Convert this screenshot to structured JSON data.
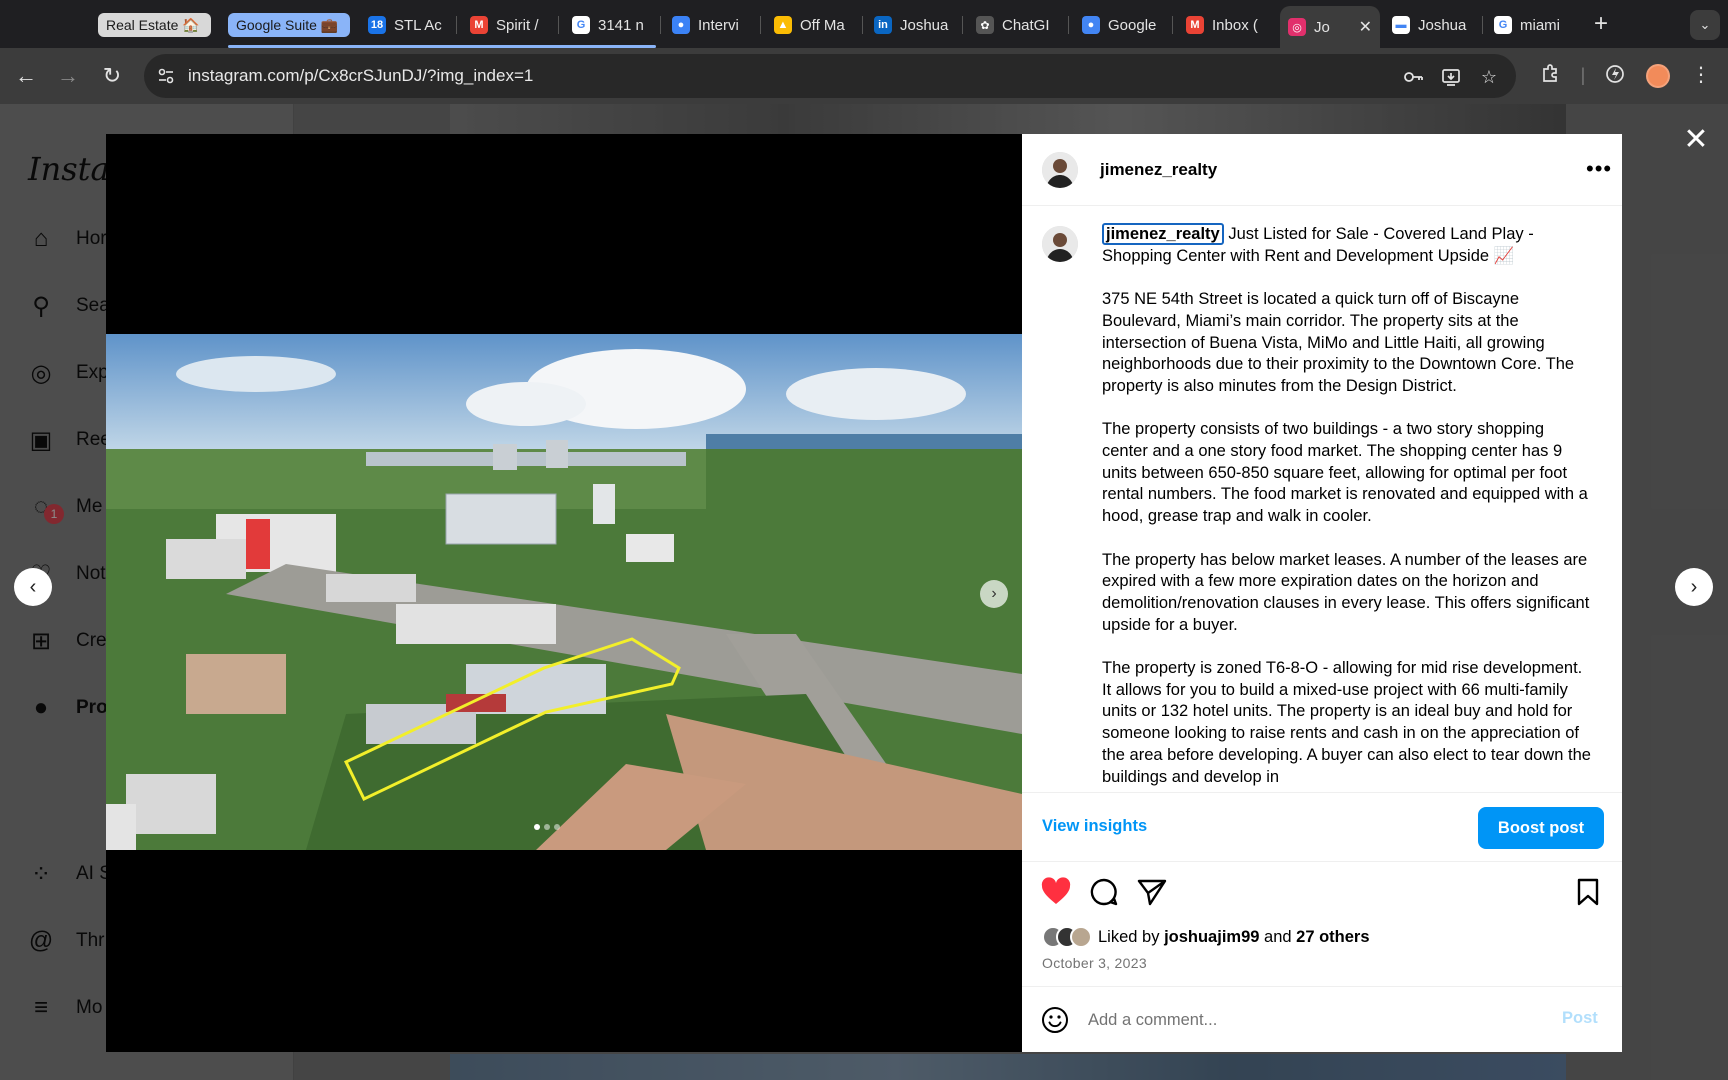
{
  "browser": {
    "tab_groups": [
      {
        "label": "Real Estate 🏠",
        "color": "#d8d8d8"
      },
      {
        "label": "Google Suite 💼",
        "color": "#8ab4f8"
      }
    ],
    "tabs": [
      {
        "title": "STL Ac",
        "icon": "calendar-icon",
        "color": "#1a73e8",
        "glyph": "18"
      },
      {
        "title": "Spirit /",
        "icon": "gmail-icon",
        "color": "#ea4335",
        "glyph": "M"
      },
      {
        "title": "3141 n",
        "icon": "google-icon",
        "color": "#ffffff",
        "glyph": "G"
      },
      {
        "title": "Intervi",
        "icon": "globe-icon",
        "color": "#3b82f6",
        "glyph": "●"
      },
      {
        "title": "Off Ma",
        "icon": "drive-icon",
        "color": "#fbbc04",
        "glyph": "▲"
      },
      {
        "title": "Joshua",
        "icon": "linkedin-icon",
        "color": "#0a66c2",
        "glyph": "in"
      },
      {
        "title": "ChatGI",
        "icon": "chatgpt-icon",
        "color": "#555555",
        "glyph": "✿"
      },
      {
        "title": "Google",
        "icon": "globe-icon",
        "color": "#4285f4",
        "glyph": "●"
      },
      {
        "title": "Inbox (",
        "icon": "gmail-icon",
        "color": "#ea4335",
        "glyph": "M"
      },
      {
        "title": "Jo",
        "icon": "instagram-icon",
        "color": "#e1306c",
        "glyph": "◎",
        "active": true
      },
      {
        "title": "Joshua",
        "icon": "page-icon",
        "color": "#ffffff",
        "glyph": "▬"
      },
      {
        "title": "miami",
        "icon": "google-icon",
        "color": "#ffffff",
        "glyph": "G"
      }
    ],
    "url": "instagram.com/p/Cx8crSJunDJ/?img_index=1"
  },
  "sidebar": {
    "logo": "Instag",
    "items": [
      {
        "label": "Hor",
        "icon": "home-icon"
      },
      {
        "label": "Sea",
        "icon": "search-icon"
      },
      {
        "label": "Exp",
        "icon": "explore-icon"
      },
      {
        "label": "Ree",
        "icon": "reels-icon"
      },
      {
        "label": "Me",
        "icon": "messages-icon",
        "badge": "1"
      },
      {
        "label": "Not",
        "icon": "heart-icon"
      },
      {
        "label": "Cre",
        "icon": "create-icon"
      },
      {
        "label": "Pro",
        "icon": "profile-avatar"
      },
      {
        "label": "AI S",
        "icon": "ai-studio-icon"
      },
      {
        "label": "Thr",
        "icon": "threads-icon"
      },
      {
        "label": "Mo",
        "icon": "menu-icon"
      }
    ]
  },
  "post": {
    "username": "jimenez_realty",
    "caption_title": "Just Listed for Sale - Covered Land Play - Shopping Center with Rent and Development Upside 📈",
    "paragraphs": [
      "375 NE 54th Street is located a quick turn off of Biscayne Boulevard, Miami’s main corridor. The property sits at the intersection of Buena Vista, MiMo and Little Haiti, all growing neighborhoods due to their proximity to the Downtown Core. The property is also minutes from the Design District.",
      "The property consists of two buildings - a two story shopping center and a one story food market. The shopping center has 9 units between 650-850 square feet, allowing for optimal per foot rental numbers. The food market is renovated and equipped with a hood, grease trap and walk in cooler.",
      "The property has below market leases. A number of the leases are expired with a few more expiration dates on the horizon and demolition/renovation clauses in every lease. This offers significant upside for a buyer.",
      "The property is zoned T6-8-O - allowing for mid rise development. It allows for you to build a mixed-use project with 66 multi-family units or 132 hotel units. The property is an ideal buy and hold for someone looking to raise rents and cash in on the appreciation of the area before developing. A buyer can also elect to tear down the buildings and develop in"
    ],
    "view_insights": "View insights",
    "boost_post": "Boost post",
    "liked_prefix": "Liked by",
    "liked_by": "joshuajim99",
    "liked_and": "and",
    "others": "27 others",
    "date": "October 3, 2023",
    "comment_placeholder": "Add a comment...",
    "post_button": "Post",
    "media_count": 3,
    "media_index": 1
  },
  "colors": {
    "accent": "#0095f6",
    "like": "#ff3040"
  }
}
